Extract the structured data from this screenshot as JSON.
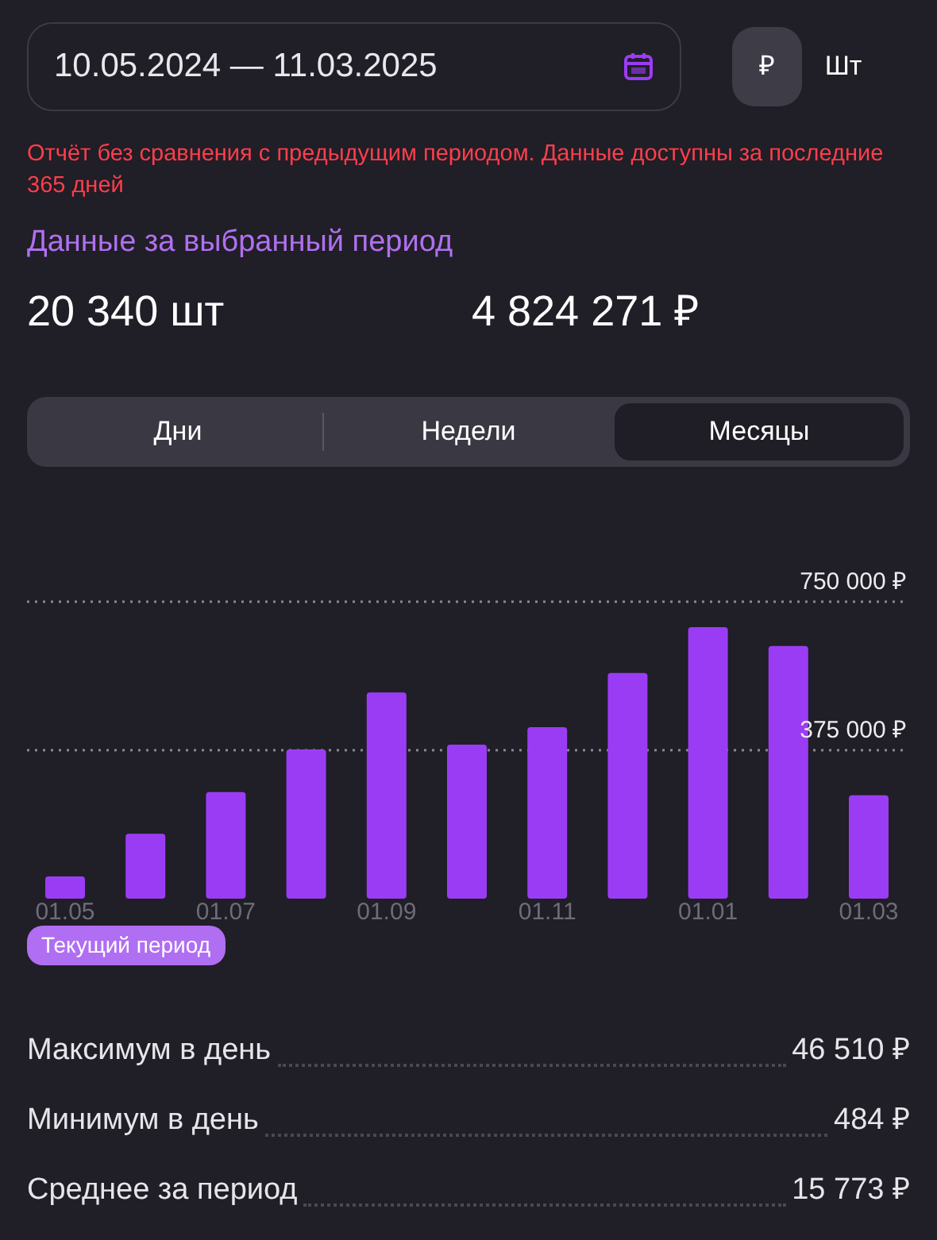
{
  "date_range": {
    "value": "10.05.2024 — 11.03.2025"
  },
  "unit_toggle": [
    {
      "label": "₽",
      "selected": true
    },
    {
      "label": "Шт",
      "selected": false
    }
  ],
  "warning": "Отчёт без сравнения с предыдущим периодом. Данные доступны за последние 365 дней",
  "section_title": "Данные за выбранный период",
  "totals": [
    {
      "value": "20 340 шт"
    },
    {
      "value": "4 824 271 ₽"
    }
  ],
  "period_tabs": [
    {
      "label": "Дни",
      "selected": false
    },
    {
      "label": "Недели",
      "selected": false
    },
    {
      "label": "Месяцы",
      "selected": true
    }
  ],
  "chart": {
    "chart_data": {
      "type": "bar",
      "categories": [
        "01.05",
        null,
        "01.07",
        null,
        "01.09",
        null,
        "01.11",
        null,
        "01.01",
        null,
        "01.03"
      ],
      "series": [
        {
          "color": "#9b3cf5",
          "values": [
            56000,
            164000,
            269000,
            377000,
            521000,
            389000,
            433000,
            570000,
            686000,
            638000,
            261000
          ]
        }
      ],
      "ylim": [
        0,
        750000
      ],
      "yticks": [
        {
          "value": 375000,
          "label": "375 000 ₽"
        },
        {
          "value": 750000,
          "label": "750 000 ₽"
        }
      ]
    },
    "legend": "Текущий период"
  },
  "stats": [
    {
      "label": "Максимум в день",
      "value": "46 510 ₽"
    },
    {
      "label": "Минимум в день",
      "value": "484 ₽"
    },
    {
      "label": "Среднее за период",
      "value": "15 773 ₽"
    }
  ]
}
